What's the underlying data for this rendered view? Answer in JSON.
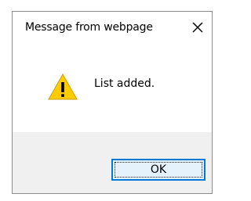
{
  "dialog": {
    "title": "Message from webpage",
    "message": "List added.",
    "icon": "warning-icon",
    "ok_label": "OK"
  },
  "colors": {
    "warning_fill": "#ffcc00",
    "warning_mark": "#000000",
    "button_border": "#0078d7",
    "button_fill": "#e5f1fb",
    "footer_fill": "#f0f0f0"
  }
}
